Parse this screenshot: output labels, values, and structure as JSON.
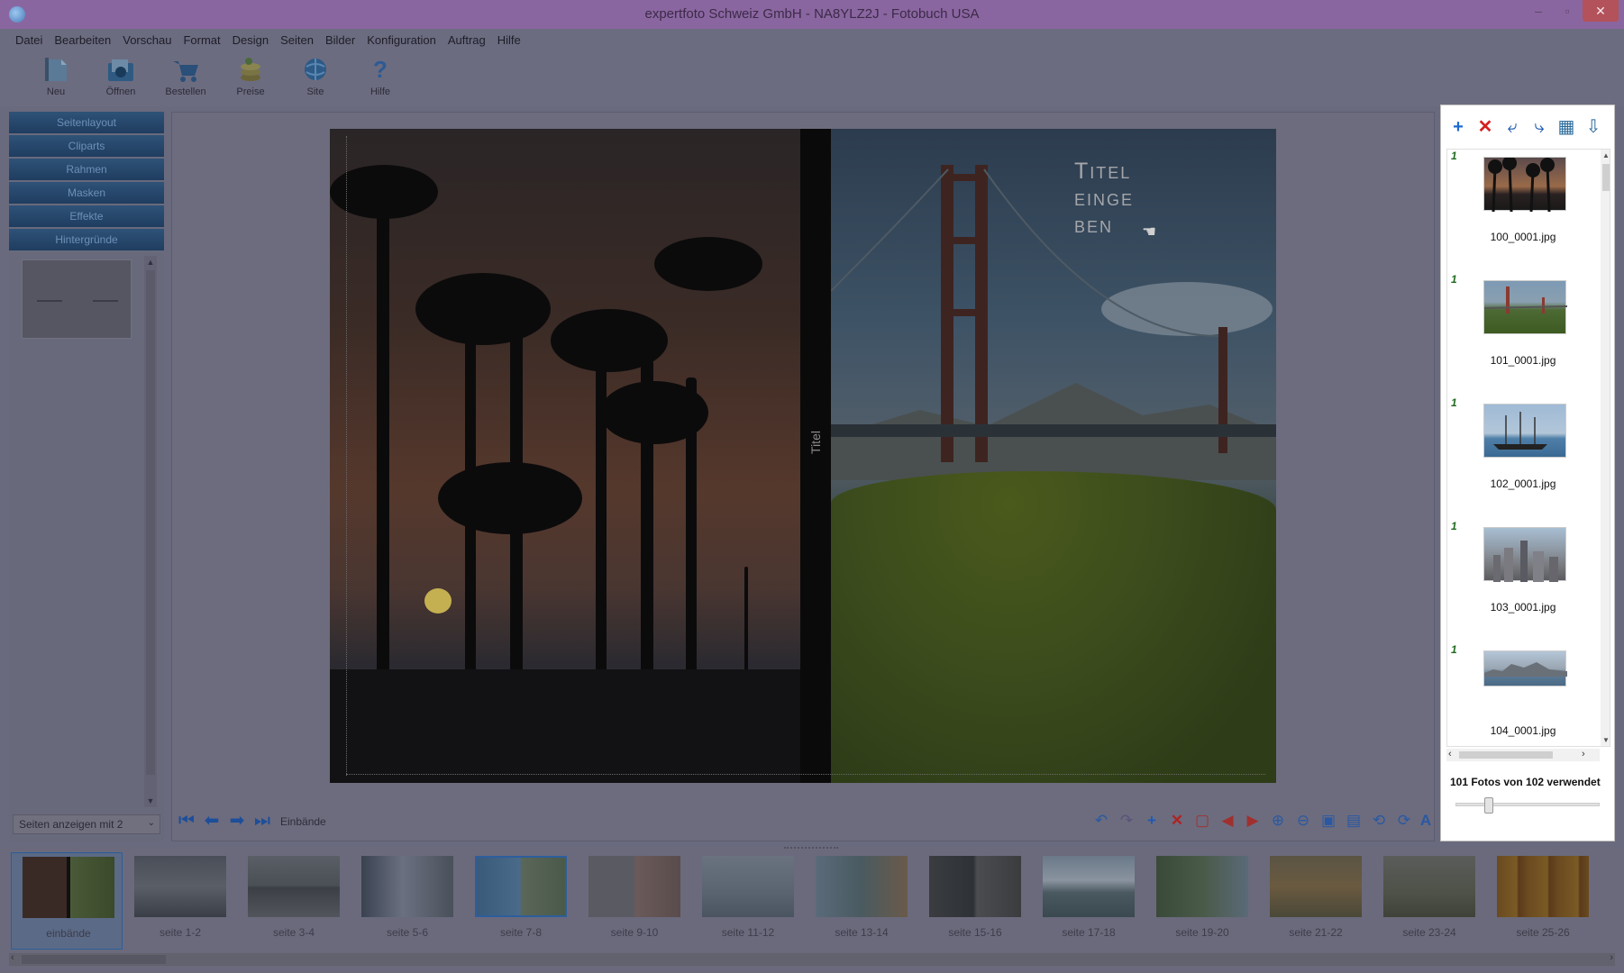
{
  "window": {
    "title": "expertfoto Schweiz GmbH - NA8YLZ2J - Fotobuch USA",
    "minimize": "–",
    "maximize": "▫",
    "close": "✕"
  },
  "menu": [
    "Datei",
    "Bearbeiten",
    "Vorschau",
    "Format",
    "Design",
    "Seiten",
    "Bilder",
    "Konfiguration",
    "Auftrag",
    "Hilfe"
  ],
  "toolbar": [
    {
      "label": "Neu",
      "icon": "new-icon"
    },
    {
      "label": "Öffnen",
      "icon": "open-icon"
    },
    {
      "label": "Bestellen",
      "icon": "cart-icon"
    },
    {
      "label": "Preise",
      "icon": "coins-icon"
    },
    {
      "label": "Site",
      "icon": "globe-icon"
    },
    {
      "label": "Hilfe",
      "icon": "help-icon"
    }
  ],
  "left_panel": {
    "sections": [
      "Seitenlayout",
      "Cliparts",
      "Rahmen",
      "Masken",
      "Effekte",
      "Hintergründe"
    ],
    "pages_select": "Seiten anzeigen mit 2"
  },
  "canvas": {
    "spine_text": "Titel",
    "title_text": [
      "Titel",
      "einge",
      "ben"
    ],
    "page_label": "Einbände"
  },
  "photos_panel": {
    "items": [
      {
        "count": "1",
        "filename": "100_0001.jpg"
      },
      {
        "count": "1",
        "filename": "101_0001.jpg"
      },
      {
        "count": "1",
        "filename": "102_0001.jpg"
      },
      {
        "count": "1",
        "filename": "103_0001.jpg"
      },
      {
        "count": "1",
        "filename": "104_0001.jpg"
      }
    ],
    "usage": "101 Fotos von 102 verwendet"
  },
  "page_strip": [
    "einbände",
    "seite 1-2",
    "seite 3-4",
    "seite 5-6",
    "seite 7-8",
    "seite 9-10",
    "seite 11-12",
    "seite 13-14",
    "seite 15-16",
    "seite 17-18",
    "seite 19-20",
    "seite 21-22",
    "seite 23-24",
    "seite 25-26"
  ],
  "colors": {
    "accent_blue": "#1e4e9a",
    "panel_button": "#2f5278",
    "selected_thumb_border": "#2c5e9c"
  }
}
